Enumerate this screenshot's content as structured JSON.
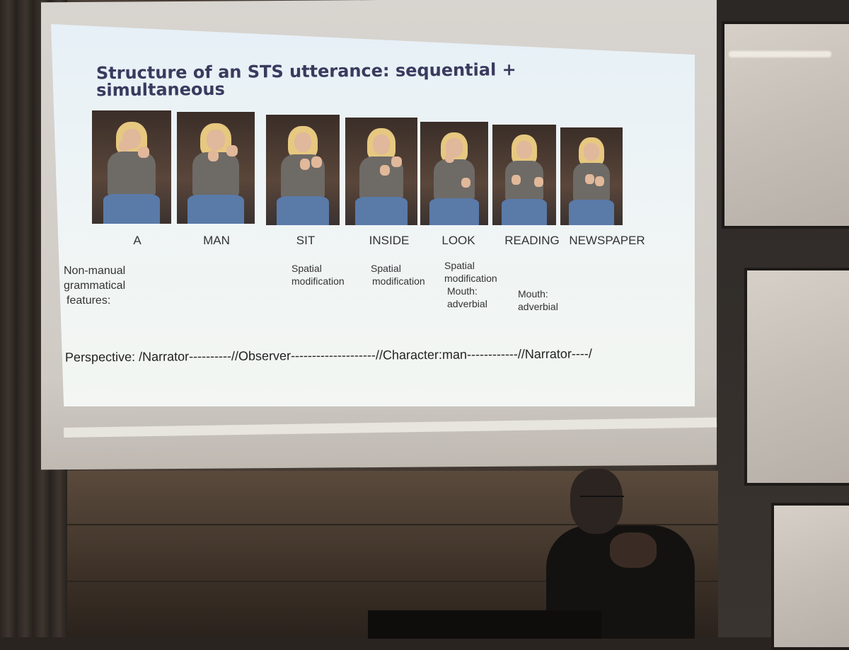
{
  "slide": {
    "title": "Structure of an STS utterance: sequential + simultaneous",
    "glosses": [
      "A",
      "MAN",
      "SIT",
      "INSIDE",
      "LOOK",
      "READING",
      "NEWSPAPER"
    ],
    "nonmanual_label": [
      "Non-manual",
      "grammatical",
      "features:"
    ],
    "notes": {
      "sit": [
        "Spatial",
        "modification"
      ],
      "inside": [
        "Spatial",
        "modification"
      ],
      "look": [
        "Spatial",
        "modification",
        "Mouth:",
        "adverbial"
      ],
      "reading": [
        "Mouth:",
        "adverbial"
      ]
    },
    "perspective": "Perspective: /Narrator----------//Observer--------------------//Character:man------------//Narrator----/"
  }
}
